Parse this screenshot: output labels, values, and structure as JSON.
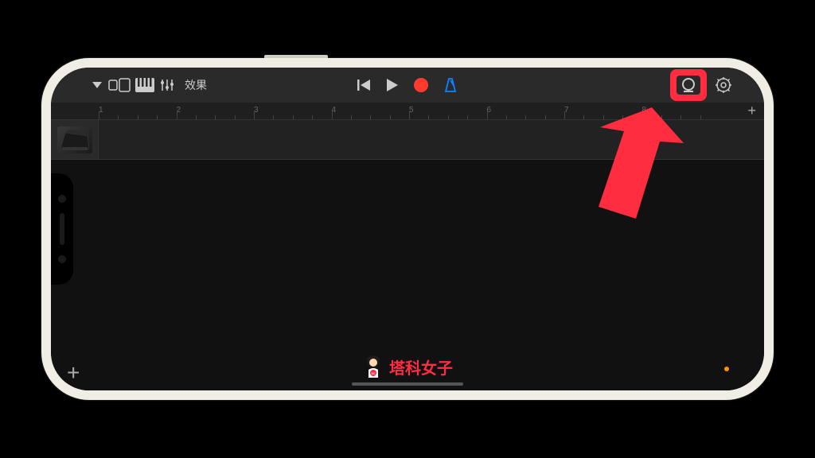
{
  "toolbar": {
    "fx_label": "效果",
    "icons": {
      "dropdown": "chevron-down",
      "view": "dual-pane",
      "instrument": "piano-keys",
      "mixer": "sliders",
      "rewind": "skip-back",
      "play": "play",
      "record": "record",
      "metronome": "metronome",
      "loop": "loop",
      "settings": "gear"
    }
  },
  "ruler": {
    "marks": [
      1,
      2,
      3,
      4,
      5,
      6,
      7,
      8
    ],
    "minor_ticks_per_mark": 4
  },
  "track": {
    "instrument": "piano"
  },
  "watermark": {
    "text": "塔科女子"
  },
  "colors": {
    "highlight": "#ff2d3f",
    "record": "#ff3b30",
    "metronome": "#0a84ff"
  }
}
